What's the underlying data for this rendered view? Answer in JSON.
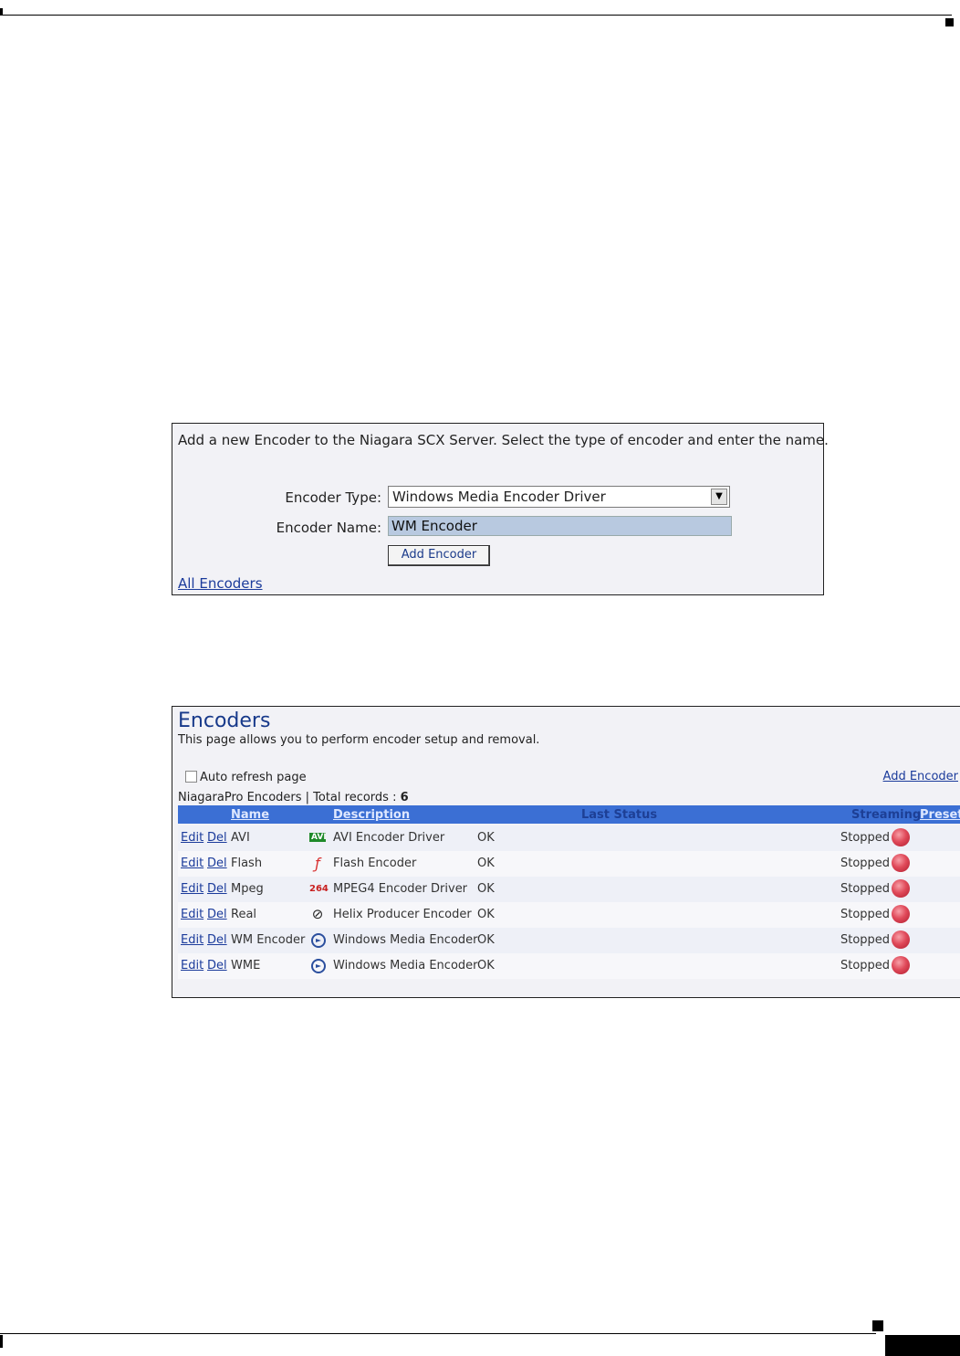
{
  "add_form": {
    "intro": "Add a new Encoder to the Niagara SCX Server. Select the type of encoder and enter the name.",
    "encoder_type_label": "Encoder Type:",
    "encoder_type_value": "Windows Media Encoder Driver",
    "encoder_name_label": "Encoder Name:",
    "encoder_name_value": "WM Encoder",
    "add_button": "Add Encoder",
    "all_encoders_link": "All Encoders"
  },
  "encoders_page": {
    "title": "Encoders",
    "subtitle": "This page allows you to perform encoder setup and removal.",
    "auto_refresh_label": "Auto refresh page",
    "auto_refresh_checked": false,
    "add_encoder_link": "Add Encoder",
    "records_prefix": "NiagaraPro Encoders | Total records :",
    "records_count": "6",
    "columns": {
      "name": "Name",
      "description": "Description",
      "last_status": "Last Status",
      "streaming": "Streaming",
      "preset": "Preset"
    },
    "rows": [
      {
        "edit": "Edit",
        "del": "Del",
        "name": "AVI",
        "icon": "avi-icon",
        "description": "AVI Encoder Driver",
        "status": "OK",
        "streaming": "Stopped"
      },
      {
        "edit": "Edit",
        "del": "Del",
        "name": "Flash",
        "icon": "flash-icon",
        "description": "Flash Encoder",
        "status": "OK",
        "streaming": "Stopped"
      },
      {
        "edit": "Edit",
        "del": "Del",
        "name": "Mpeg",
        "icon": "mpeg4-icon",
        "description": "MPEG4 Encoder Driver",
        "status": "OK",
        "streaming": "Stopped"
      },
      {
        "edit": "Edit",
        "del": "Del",
        "name": "Real",
        "icon": "helix-icon",
        "description": "Helix Producer Encoder",
        "status": "OK",
        "streaming": "Stopped"
      },
      {
        "edit": "Edit",
        "del": "Del",
        "name": "WM Encoder",
        "icon": "windows-media-icon",
        "description": "Windows Media Encoder",
        "status": "OK",
        "streaming": "Stopped"
      },
      {
        "edit": "Edit",
        "del": "Del",
        "name": "WME",
        "icon": "windows-media-icon",
        "description": "Windows Media Encoder",
        "status": "OK",
        "streaming": "Stopped"
      }
    ],
    "icon_glyphs": {
      "avi": "AVI",
      "mpeg4": "264"
    }
  }
}
